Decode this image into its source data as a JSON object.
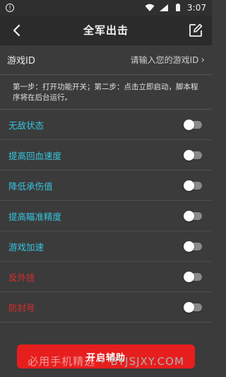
{
  "status_bar": {
    "time": "3:07",
    "icons": [
      "alert-icon",
      "wifi-icon",
      "signal-icon",
      "battery-icon"
    ]
  },
  "header": {
    "title": "全军出击",
    "back_icon": "back-arrow-icon",
    "edit_icon": "edit-icon"
  },
  "game_id": {
    "label": "游戏ID",
    "placeholder": "请输入您的游戏ID"
  },
  "instructions": "第一步：打开功能开关；第二步：点击立即启动，脚本程序将在后台运行。",
  "features": [
    {
      "label": "无敌状态",
      "color": "#35c6df",
      "on": false
    },
    {
      "label": "提高回血速度",
      "color": "#35c6df",
      "on": false
    },
    {
      "label": "降低承伤值",
      "color": "#35c6df",
      "on": false
    },
    {
      "label": "提高瞄准精度",
      "color": "#35c6df",
      "on": false
    },
    {
      "label": "游戏加速",
      "color": "#35c6df",
      "on": false
    },
    {
      "label": "反外挂",
      "color": "#e02b2b",
      "on": false
    },
    {
      "label": "防封号",
      "color": "#e02b2b",
      "on": false
    }
  ],
  "action": {
    "start_label": "开启辅助",
    "color": "#e61e1e"
  },
  "watermark": {
    "text": "必用手机精选",
    "sub": "• BYJSJXY.COM"
  }
}
